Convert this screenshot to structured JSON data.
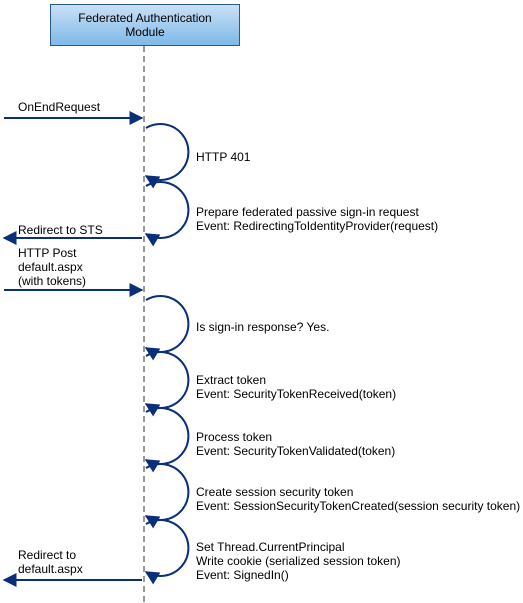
{
  "participant": {
    "title_line1": "Federated Authentication",
    "title_line2": "Module"
  },
  "messages": {
    "on_end_request": "OnEndRequest",
    "redirect_to_sts": "Redirect to STS",
    "http_post_line1": "HTTP Post",
    "http_post_line2": "default.aspx",
    "http_post_line3": "(with tokens)",
    "redirect_default_line1": "Redirect to",
    "redirect_default_line2": "default.aspx"
  },
  "steps": {
    "http_401": "HTTP 401",
    "prepare_line1": "Prepare federated passive sign-in request",
    "prepare_line2": "Event: RedirectingToIdentityProvider(request)",
    "signin_resp": "Is sign-in response? Yes.",
    "extract_line1": "Extract token",
    "extract_line2": "Event: SecurityTokenReceived(token)",
    "process_line1": "Process token",
    "process_line2": "Event: SecurityTokenValidated(token)",
    "create_line1": "Create session security token",
    "create_line2": "Event: SessionSecurityTokenCreated(session security token)",
    "set_line1": "Set Thread.CurrentPrincipal",
    "set_line2": "Write cookie (serialized session token)",
    "set_line3": "Event: SignedIn()"
  }
}
